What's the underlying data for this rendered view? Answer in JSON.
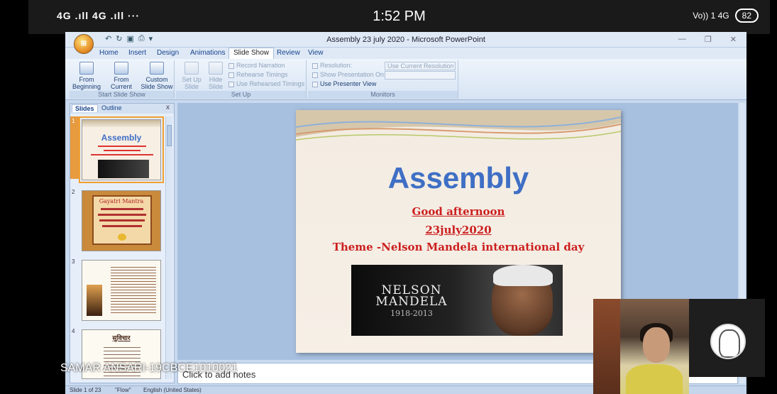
{
  "phone_status": {
    "signal": "4G .ıll 4G .ıll ···",
    "time": "1:52 PM",
    "right_icons": "Vo)) 1  4G",
    "battery": "82"
  },
  "window": {
    "title": "Assembly 23 july 2020 - Microsoft PowerPoint",
    "office_button": "Office"
  },
  "tabs": [
    "Home",
    "Insert",
    "Design",
    "Animations",
    "Slide Show",
    "Review",
    "View"
  ],
  "active_tab": "Slide Show",
  "ribbon": {
    "start_group": {
      "label": "Start Slide Show",
      "buttons": [
        "From Beginning",
        "From Current Slide",
        "Custom Slide Show"
      ]
    },
    "setup_group": {
      "label": "Set Up",
      "buttons": [
        "Set Up Slide Show",
        "Hide Slide"
      ],
      "items": [
        "Record Narration",
        "Rehearse Timings",
        "Use Rehearsed Timings"
      ]
    },
    "monitors_group": {
      "label": "Monitors",
      "resolution_label": "Resolution:",
      "resolution_value": "Use Current Resolution",
      "show_on_label": "Show Presentation On:",
      "presenter_view": "Use Presenter View"
    }
  },
  "panel": {
    "tab_slides": "Slides",
    "tab_outline": "Outline",
    "close": "x",
    "thumbs": [
      {
        "num": "1",
        "title": "Assembly"
      },
      {
        "num": "2",
        "title": "Gayatri Mantra"
      },
      {
        "num": "3",
        "title": ""
      },
      {
        "num": "4",
        "title": "सुविचार"
      }
    ]
  },
  "slide": {
    "title": "Assembly",
    "line1": "Good afternoon",
    "line2": "23july2020",
    "line3": "Theme -Nelson Mandela international day",
    "image_name": "NELSON MANDELA",
    "image_years": "1918-2013"
  },
  "notes_placeholder": "Click to add notes",
  "statusbar": {
    "slide_info": "Slide 1 of 23",
    "theme": "\"Flow\"",
    "language": "English (United States)"
  },
  "participant_name": "SAMAR ANSARI-19CBCE1010021"
}
